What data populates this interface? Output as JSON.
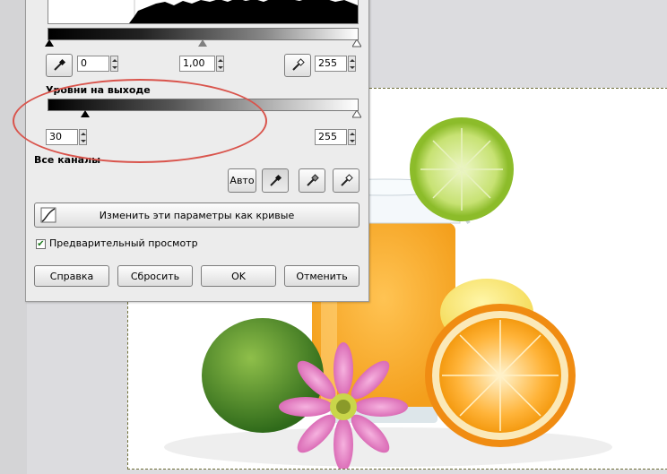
{
  "input_levels": {
    "low_value": "0",
    "gamma_value": "1,00",
    "high_value": "255"
  },
  "output_levels": {
    "title": "Уровни на выходе",
    "low_value": "30",
    "high_value": "255"
  },
  "channels": {
    "label": "Все каналы",
    "auto_label": "Авто"
  },
  "curves_button": {
    "label": "Изменить эти параметры как кривые"
  },
  "preview": {
    "label": "Предварительный просмотр",
    "checked": true
  },
  "buttons": {
    "help": "Справка",
    "reset": "Сбросить",
    "ok": "OK",
    "cancel": "Отменить"
  },
  "colors": {
    "annotation_oval": "#d9544c",
    "selection_border": "#6f6f3a",
    "dialog_bg": "#ececec"
  }
}
